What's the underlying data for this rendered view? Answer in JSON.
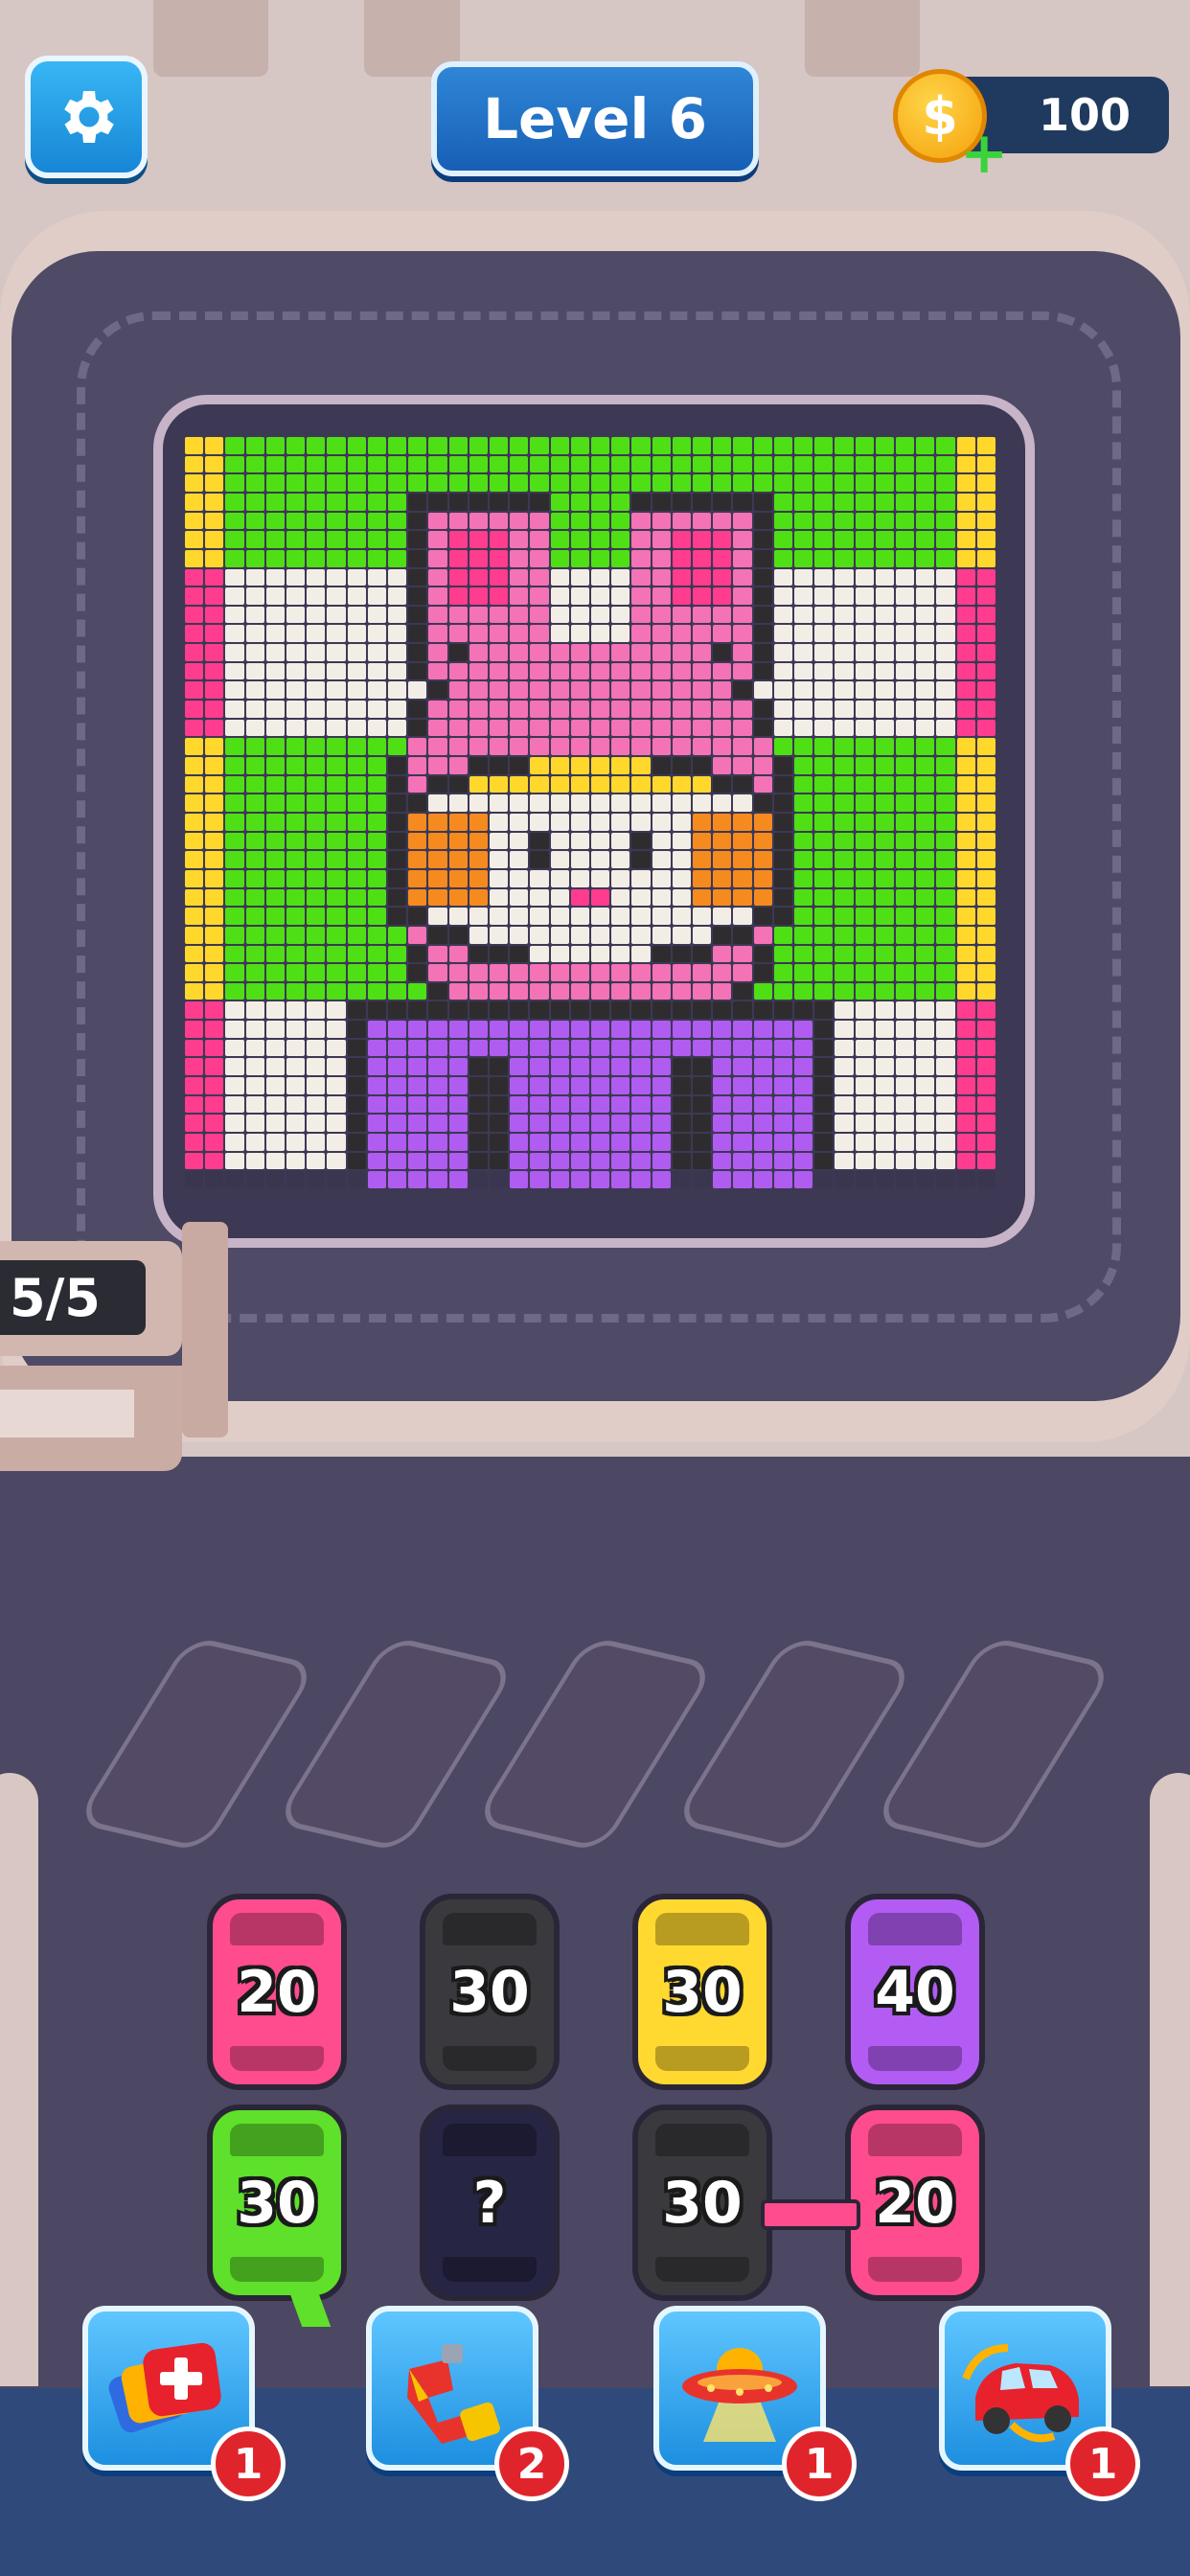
{
  "header": {
    "level_label": "Level 6",
    "coins": "100",
    "settings_icon": "gear-icon",
    "coin_icon": "coin-icon",
    "coin_symbol": "$",
    "add_coins_icon": "plus-icon"
  },
  "gate": {
    "counter": "5/5"
  },
  "puzzle": {
    "colors": {
      "Y": "#ffd82b",
      "G": "#4ee014",
      "P": "#f472b6",
      "W": "#f2eee6",
      "K": "#2e2c2e",
      "O": "#f58a1f",
      "V": "#b05cf0",
      "M": "#ff3c8e",
      "D": "#3a3650"
    }
  },
  "queue_slots": 5,
  "cars": [
    {
      "value": "20",
      "color": "#ff4c8e",
      "hidden": false
    },
    {
      "value": "30",
      "color": "#3a3a3e",
      "hidden": false
    },
    {
      "value": "30",
      "color": "#ffd930",
      "hidden": false
    },
    {
      "value": "40",
      "color": "#b25cf4",
      "hidden": false
    },
    {
      "value": "30",
      "color": "#5fe02a",
      "hidden": false
    },
    {
      "value": "?",
      "color": "#262544",
      "hidden": true
    },
    {
      "value": "30",
      "color": "#3a3a3e",
      "hidden": false
    },
    {
      "value": "20",
      "color": "#ff4c8e",
      "hidden": false
    }
  ],
  "boosters": [
    {
      "name": "add-slot-booster",
      "icon": "cards-plus-icon",
      "count": "1"
    },
    {
      "name": "magnet-booster",
      "icon": "magnet-icon",
      "count": "2"
    },
    {
      "name": "ufo-booster",
      "icon": "ufo-icon",
      "count": "1"
    },
    {
      "name": "shuffle-booster",
      "icon": "car-shuffle-icon",
      "count": "1"
    }
  ]
}
